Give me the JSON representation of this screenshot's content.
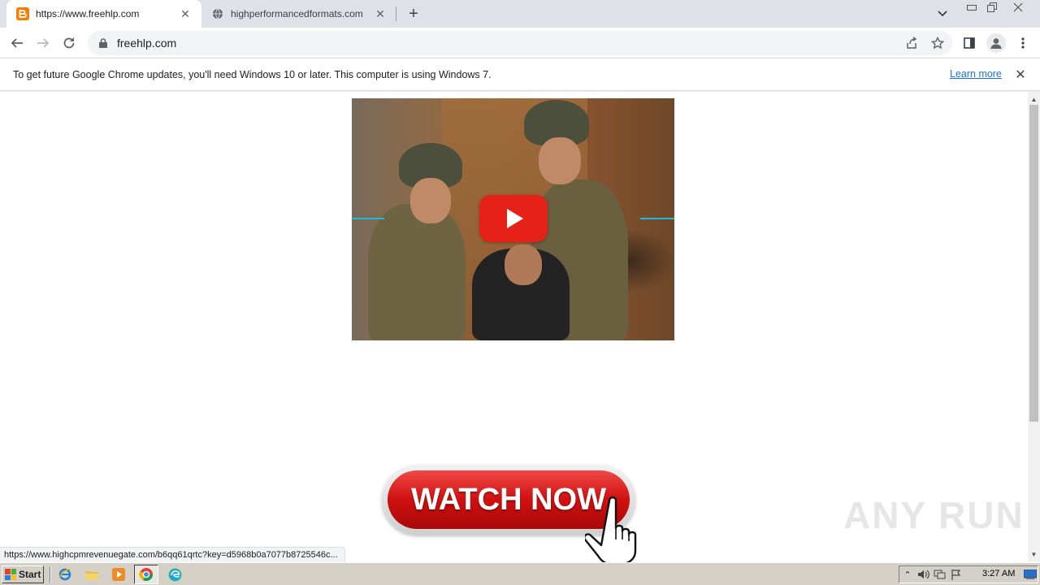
{
  "browser": {
    "tabs": [
      {
        "title": "https://www.freehlp.com",
        "favicon": "blogger-icon",
        "active": true
      },
      {
        "title": "highperformancedformats.com",
        "favicon": "globe-icon",
        "active": false
      }
    ],
    "address": "freehlp.com"
  },
  "infobar": {
    "message": "To get future Google Chrome updates, you'll need Windows 10 or later. This computer is using Windows 7.",
    "link": "Learn more"
  },
  "page": {
    "video": {
      "play_button": "youtube-play"
    },
    "cta_label": "WATCH NOW",
    "watermark": "ANY RUN"
  },
  "status_url": "https://www.highcpmrevenuegate.com/b6qq61qrtc?key=d5968b0a7077b8725546c...",
  "taskbar": {
    "start_label": "Start",
    "clock": "3:27 AM"
  },
  "colors": {
    "youtube_red": "#e62117",
    "cta_red": "#d01010",
    "link_blue": "#1a73e8",
    "blogger_orange": "#f57d00"
  }
}
